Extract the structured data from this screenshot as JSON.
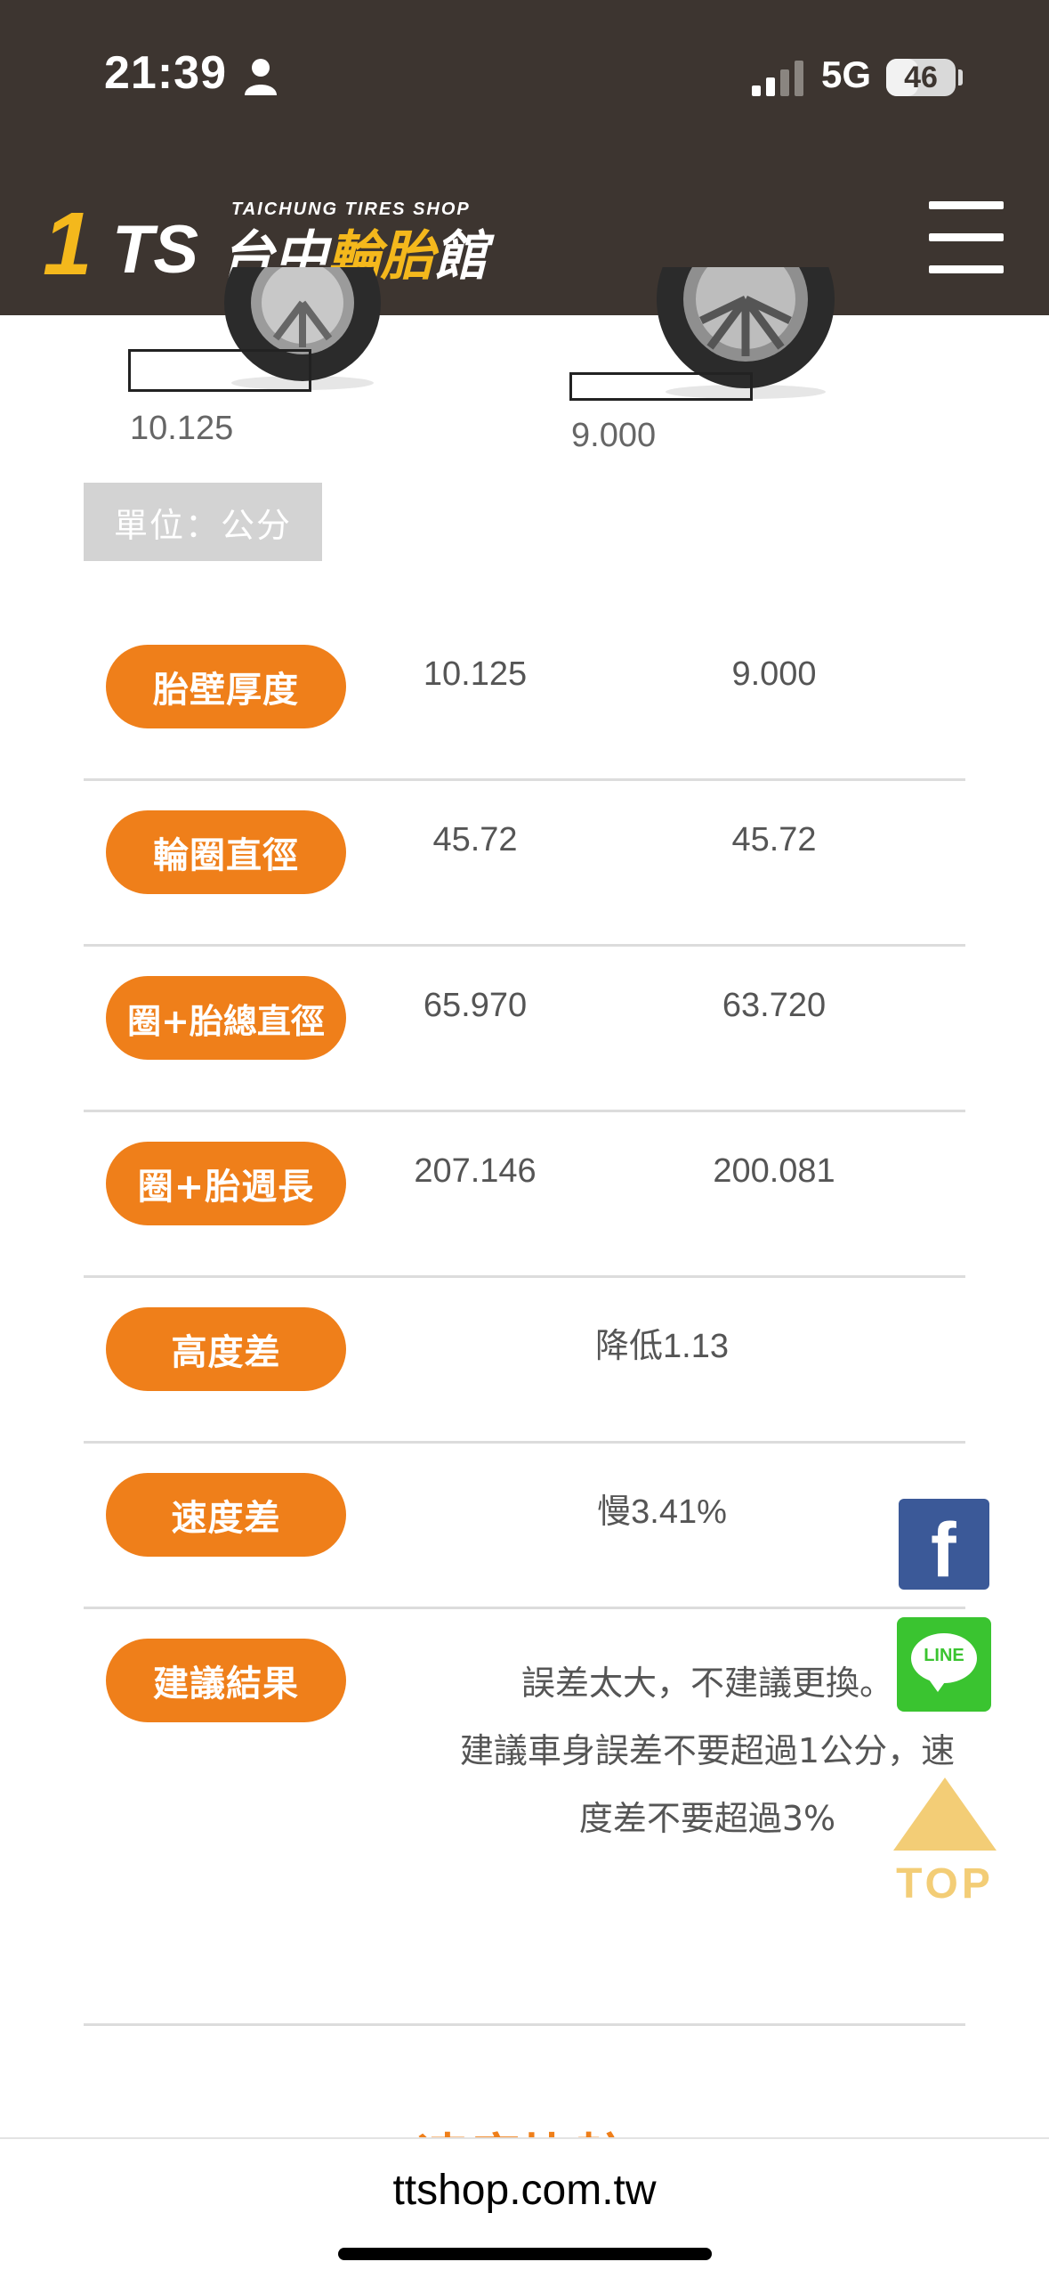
{
  "status_bar": {
    "time": "21:39",
    "network": "5G",
    "battery": "46",
    "battery_level_pct": 46
  },
  "header": {
    "logo_number": "1",
    "logo_letters": "TS",
    "logo_english": "TAICHUNG TIRES SHOP",
    "logo_chinese_white": "台中",
    "logo_chinese_yellow": "輪胎",
    "logo_chinese_end": "館",
    "menu_icon": "hamburger-menu-icon"
  },
  "tires": {
    "left_value": "10.125",
    "right_value": "9.000"
  },
  "unit_label": "單位：公分",
  "rows": [
    {
      "label": "胎壁厚度",
      "left": "10.125",
      "right": "9.000"
    },
    {
      "label": "輪圈直徑",
      "left": "45.72",
      "right": "45.72"
    },
    {
      "label": "圈+胎總直徑",
      "left": "65.970",
      "right": "63.720"
    },
    {
      "label": "圈+胎週長",
      "left": "207.146",
      "right": "200.081"
    },
    {
      "label": "高度差",
      "value": "降低1.13"
    },
    {
      "label": "速度差",
      "value": "慢3.41%"
    },
    {
      "label": "建議結果",
      "line1": "誤差太大，不建議更換。",
      "line2": "建議車身誤差不要超過1公分，速",
      "line3": "度差不要超過3%"
    }
  ],
  "next_section_title": "速度比較",
  "floating": {
    "facebook_icon": "facebook-icon",
    "line_label": "LINE",
    "top_label": "TOP"
  },
  "browser": {
    "url": "ttshop.com.tw"
  },
  "colors": {
    "header_bg": "#3d3530",
    "accent_orange": "#ef7f1a",
    "logo_yellow": "#f4b81c",
    "facebook_blue": "#3b5998",
    "line_green": "#3ac430"
  }
}
